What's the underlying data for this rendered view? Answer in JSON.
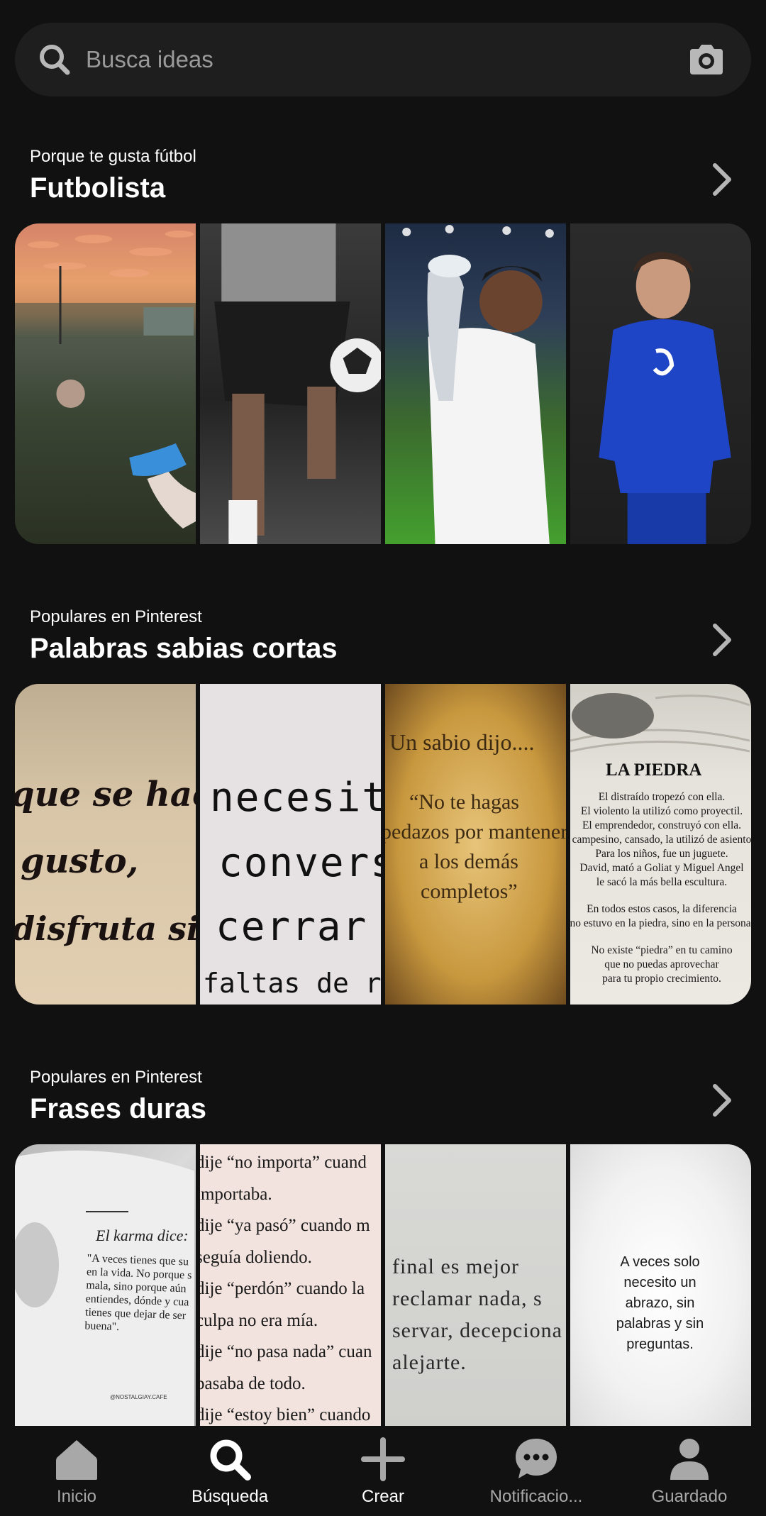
{
  "search": {
    "placeholder": "Busca ideas",
    "icon": "search-icon",
    "camera_icon": "camera-icon"
  },
  "sections": [
    {
      "subtitle": "Porque te gusta fútbol",
      "title": "Futbolista",
      "images": [
        "football-field-sunset",
        "player-juggling-ball",
        "player-with-trophy",
        "player-blue-kit"
      ]
    },
    {
      "subtitle": "Populares en Pinterest",
      "title": "Palabras sabias cortas",
      "quotes": {
        "q1": [
          "que se hac",
          "gusto,",
          "disfruta sin"
        ],
        "q2": [
          "necesita",
          "conversa",
          "cerrar c",
          "faltas de respe"
        ],
        "q3": [
          "Un sabio dijo....",
          "“No te hagas",
          "pedazos por mantener",
          "a los demás",
          "completos”"
        ],
        "q4": {
          "title": "LA PIEDRA",
          "lines": [
            "El distraído tropezó con ella.",
            "El violento la utilizó como proyectil.",
            "El emprendedor, construyó con ella.",
            "campesino, cansado, la utilizó de asiento",
            "Para los niños, fue un juguete.",
            "David, mató a Goliat y Miguel Angel",
            "le sacó la más bella escultura.",
            "",
            "En todos estos casos, la diferencia",
            "no estuvo en la piedra, sino en la persona.",
            "",
            "No existe “piedra” en tu camino",
            "que no puedas aprovechar",
            "para tu propio crecimiento."
          ]
        }
      }
    },
    {
      "subtitle": "Populares en Pinterest",
      "title": "Frases duras",
      "quotes": {
        "q1": {
          "title": "El karma dice:",
          "lines": [
            "\"A veces tienes que su",
            "en la vida. No porque s",
            "mala, sino porque aún",
            "entiendes, dónde y cua",
            "tienes que dejar de ser",
            "buena\"."
          ],
          "credit": "@NOSTALGIAY.CAFE"
        },
        "q2": [
          "dije “no importa” cuand",
          "importaba.",
          "dije “ya pasó” cuando m",
          "seguía doliendo.",
          "dije “perdón” cuando la",
          "culpa no era mía.",
          "dije “no pasa nada” cuan",
          "pasaba de todo.",
          "dije “estoy bien” cuando"
        ],
        "q3": [
          "final es mejor",
          "reclamar nada, s",
          "servar, decepciona",
          "alejarte."
        ],
        "q4": [
          "A veces solo",
          "necesito un",
          "abrazo, sin",
          "palabras y sin",
          "preguntas."
        ]
      }
    }
  ],
  "nav": [
    {
      "label": "Inicio",
      "icon": "home-icon",
      "active": false
    },
    {
      "label": "Búsqueda",
      "icon": "search-icon",
      "active": true
    },
    {
      "label": "Crear",
      "icon": "plus-icon",
      "active": false
    },
    {
      "label": "Notificacio...",
      "icon": "chat-bubble-icon",
      "active": false
    },
    {
      "label": "Guardado",
      "icon": "profile-icon",
      "active": false
    }
  ]
}
